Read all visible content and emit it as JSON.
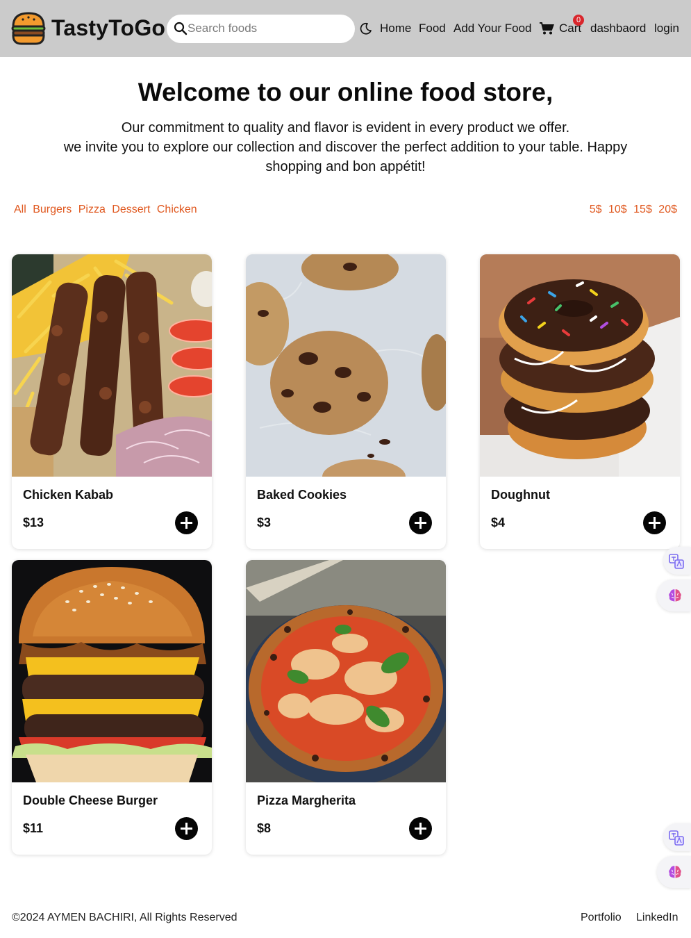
{
  "header": {
    "brand": "TastyToGo",
    "search_placeholder": "Search foods",
    "nav": {
      "home": "Home",
      "food": "Food",
      "add_food": "Add Your Food",
      "cart": "Cart",
      "cart_count": "0",
      "dashboard": "dashbaord",
      "login": "login"
    },
    "icons": [
      "burger-logo-icon",
      "search-icon",
      "moon-icon",
      "cart-icon"
    ]
  },
  "hero": {
    "title": "Welcome to our online food store,",
    "line1": "Our commitment to quality and flavor is evident in every product we offer.",
    "line2": "we invite you to explore our collection and discover the perfect addition to your table. Happy shopping and bon appétit!"
  },
  "filters": {
    "categories": [
      "All",
      "Burgers",
      "Pizza",
      "Dessert",
      "Chicken"
    ],
    "prices": [
      "5$",
      "10$",
      "15$",
      "20$"
    ]
  },
  "products": [
    {
      "name": "Chicken Kabab",
      "price": "$13",
      "image": "kabab skewers with fries"
    },
    {
      "name": "Baked Cookies",
      "price": "$3",
      "image": "chocolate chip cookies"
    },
    {
      "name": "Doughnut",
      "price": "$4",
      "image": "stacked doughnuts with sprinkles"
    },
    {
      "name": "Double Cheese Burger",
      "price": "$11",
      "image": "double cheeseburger"
    },
    {
      "name": "Pizza Margherita",
      "price": "$8",
      "image": "margherita pizza"
    }
  ],
  "footer": {
    "copyright": "©2024 AYMEN BACHIRI, All Rights Reserved",
    "portfolio": "Portfolio",
    "linkedin": "LinkedIn"
  },
  "colors": {
    "navbar_bg": "#cbcbcb",
    "accent": "#e0581f",
    "badge": "#d9262c",
    "add_button": "#050505"
  }
}
